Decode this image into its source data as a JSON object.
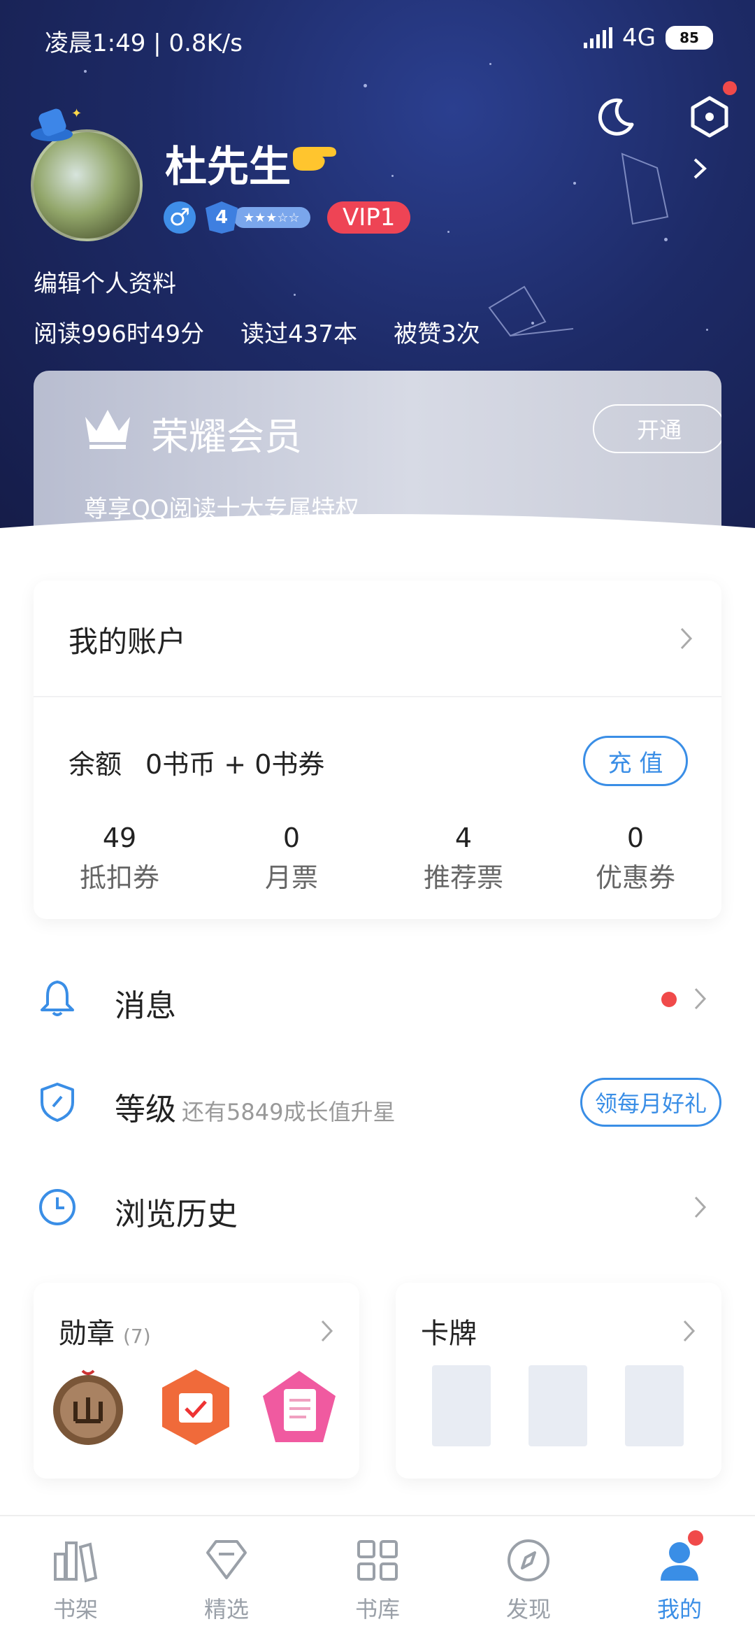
{
  "status": {
    "time": "凌晨1:49",
    "speed": "0.8K/s",
    "network": "4G",
    "battery": "85"
  },
  "profile": {
    "name": "杜先生",
    "level": "4",
    "vip": "VIP1",
    "edit_label": "编辑个人资料",
    "stats": [
      "阅读996时49分",
      "读过437本",
      "被赞3次"
    ]
  },
  "vip_card": {
    "title": "荣耀会员",
    "subtitle": "尊享QQ阅读十大专属特权",
    "button": "开通"
  },
  "account": {
    "title": "我的账户",
    "balance_label": "余额",
    "balance_value": "0书币 + 0书券",
    "recharge": "充 值",
    "tickets": [
      {
        "num": "49",
        "label": "抵扣券"
      },
      {
        "num": "0",
        "label": "月票"
      },
      {
        "num": "4",
        "label": "推荐票"
      },
      {
        "num": "0",
        "label": "优惠券"
      }
    ]
  },
  "menu": {
    "messages": "消息",
    "level": "等级",
    "level_hint": "还有5849成长值升星",
    "level_button": "领每月好礼",
    "history": "浏览历史"
  },
  "medals": {
    "title": "勋章",
    "count": "(7)"
  },
  "cards": {
    "title": "卡牌"
  },
  "tabs": [
    {
      "label": "书架",
      "icon": "bookshelf-icon"
    },
    {
      "label": "精选",
      "icon": "diamond-icon"
    },
    {
      "label": "书库",
      "icon": "grid-icon"
    },
    {
      "label": "发现",
      "icon": "compass-icon"
    },
    {
      "label": "我的",
      "icon": "user-icon"
    }
  ],
  "colors": {
    "accent": "#3a8ee6",
    "hero": "#1d2a66",
    "vip_red": "#ee4455",
    "badge_red": "#f04a4a"
  }
}
